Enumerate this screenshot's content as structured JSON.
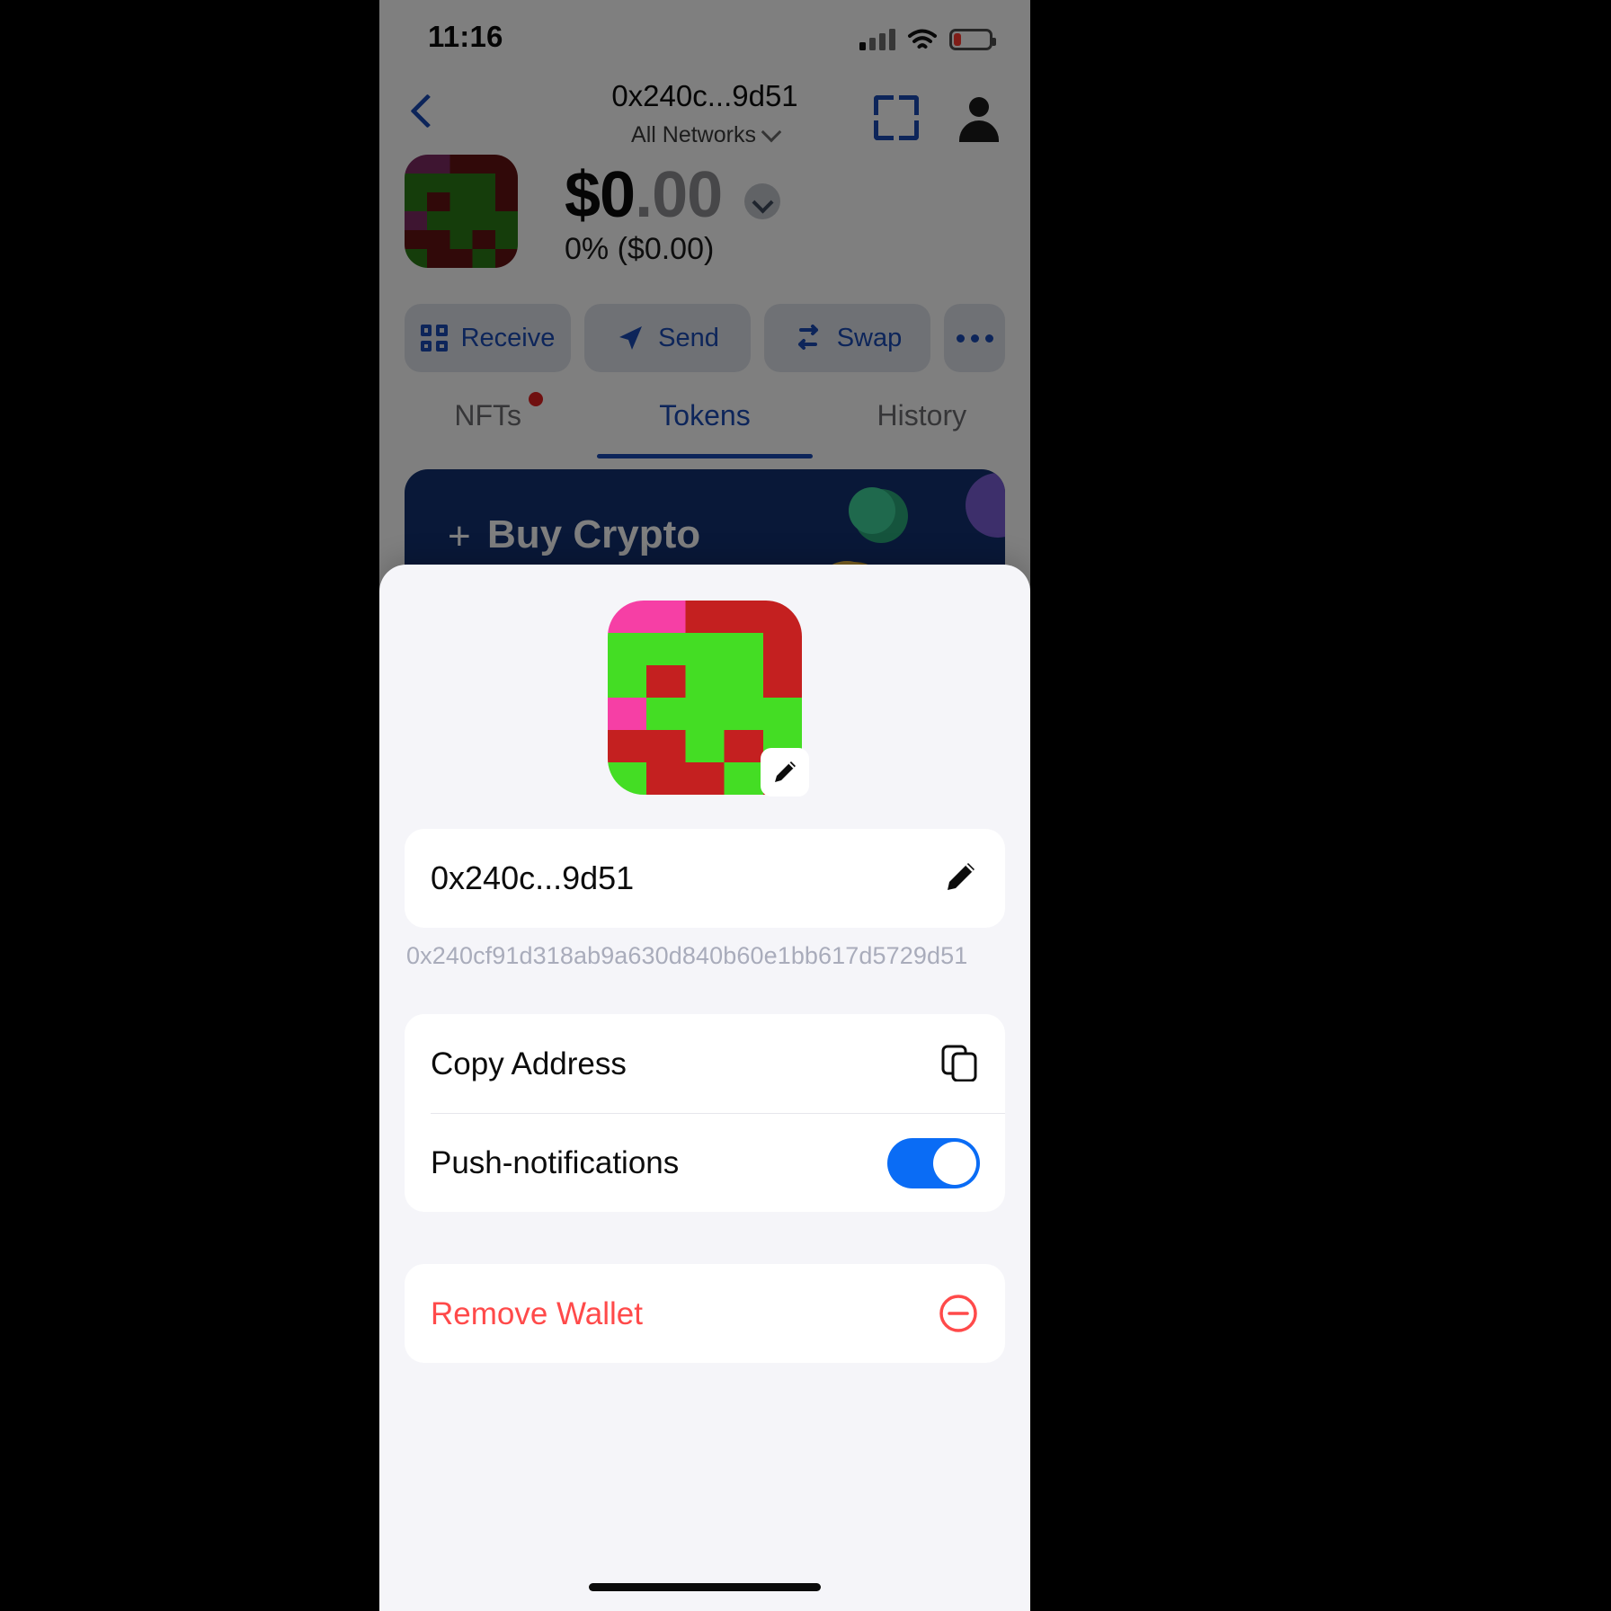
{
  "status_bar": {
    "time": "11:16",
    "signal_icon": "cellular-bars-icon",
    "wifi_icon": "wifi-icon",
    "battery_icon": "battery-low-icon"
  },
  "header": {
    "back_icon": "chevron-left-icon",
    "title": "0x240c...9d51",
    "network_label": "All Networks",
    "network_chevron": "chevron-down-icon",
    "scan_icon": "scan-qr-icon",
    "profile_icon": "person-icon"
  },
  "balance": {
    "avatar_icon": "wallet-identicon",
    "amount_major": "$0",
    "amount_minor": ".00",
    "expand_icon": "chevron-down-circle-icon",
    "change": "0% ($0.00)"
  },
  "actions": [
    {
      "label": "Receive",
      "icon": "qr-code-icon"
    },
    {
      "label": "Send",
      "icon": "paper-plane-icon"
    },
    {
      "label": "Swap",
      "icon": "swap-arrows-icon"
    },
    {
      "label": "",
      "icon": "ellipsis-icon"
    }
  ],
  "tabs": [
    {
      "label": "NFTs",
      "active": false,
      "badge": true
    },
    {
      "label": "Tokens",
      "active": true,
      "badge": false
    },
    {
      "label": "History",
      "active": false,
      "badge": false
    }
  ],
  "banner": {
    "plus": "+",
    "label": "Buy Crypto"
  },
  "sheet": {
    "avatar_icon": "wallet-identicon-large",
    "avatar_edit_icon": "pencil-icon",
    "address_short": "0x240c...9d51",
    "address_edit_icon": "pencil-icon",
    "address_full": "0x240cf91d318ab9a630d840b60e1bb617d5729d51",
    "rows": [
      {
        "label": "Copy Address",
        "icon": "copy-icon",
        "control": "icon"
      },
      {
        "label": "Push-notifications",
        "icon": "toggle-switch",
        "control": "toggle",
        "toggle_on": true
      }
    ],
    "remove": {
      "label": "Remove Wallet",
      "icon": "minus-circle-icon"
    }
  },
  "colors": {
    "accent_blue": "#1a4ab5",
    "toggle_blue": "#0a6cf5",
    "danger_red": "#ff4a4a",
    "banner_blue": "#123070",
    "sheet_bg": "#f5f5f9",
    "identicon_pink": "#f63fa5",
    "identicon_green": "#44dd24",
    "identicon_red": "#c42020"
  },
  "identicon_grid": [
    [
      "pink",
      "pink",
      "red",
      "red",
      "red"
    ],
    [
      "green",
      "green",
      "green",
      "green",
      "red"
    ],
    [
      "green",
      "red",
      "green",
      "green",
      "red"
    ],
    [
      "pink",
      "green",
      "green",
      "green",
      "green"
    ],
    [
      "red",
      "red",
      "green",
      "red",
      "green"
    ],
    [
      "green",
      "red",
      "red",
      "green",
      "red"
    ]
  ]
}
